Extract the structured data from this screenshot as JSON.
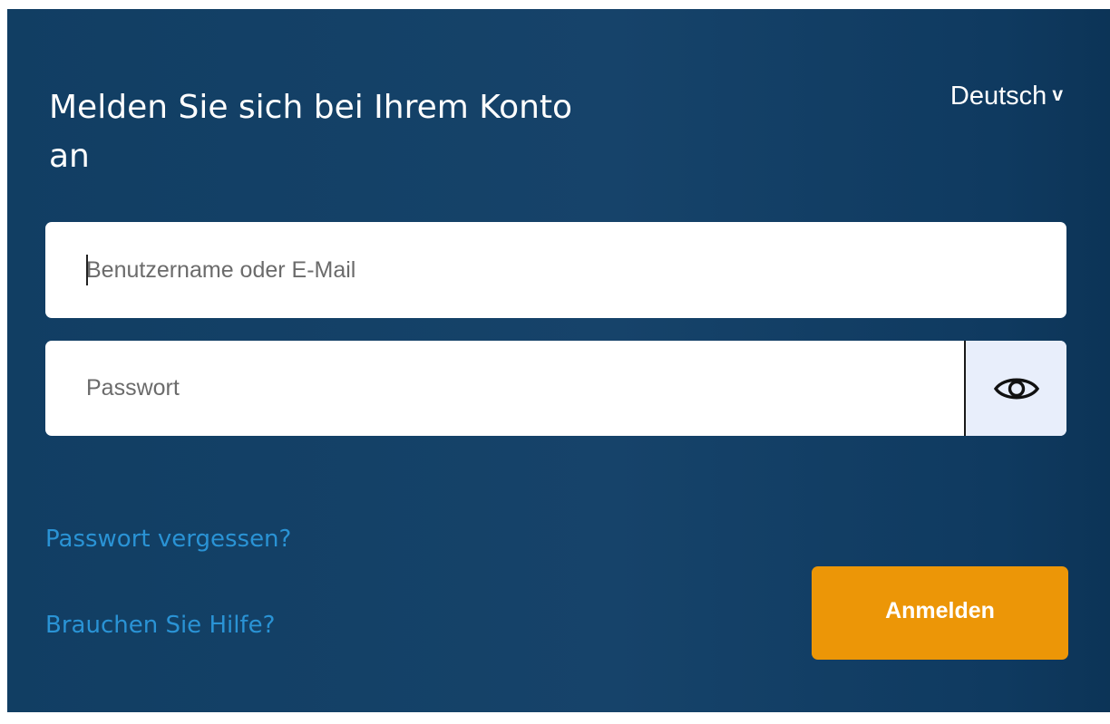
{
  "login": {
    "title": "Melden Sie sich bei Ihrem Konto an",
    "language": {
      "selected": "Deutsch",
      "chevron": "v",
      "icon": "chevron-down-icon"
    },
    "username": {
      "placeholder": "Benutzername oder E-Mail",
      "value": ""
    },
    "password": {
      "placeholder": "Passwort",
      "value": "",
      "toggle_icon": "eye-icon"
    },
    "forgot_password_link": "Passwort vergessen?",
    "help_link": "Brauchen Sie Hilfe?",
    "submit_label": "Anmelden"
  },
  "colors": {
    "panel_background": "#16436a",
    "link": "#2a93d5",
    "button": "#ec9607",
    "eye_button_background": "#e8eefb"
  }
}
